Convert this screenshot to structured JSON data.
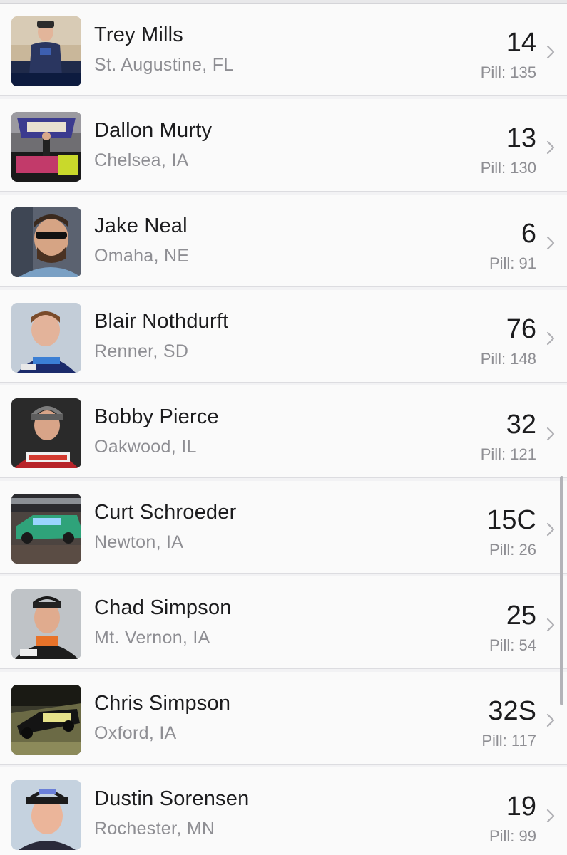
{
  "drivers": [
    {
      "name": "Trey Mills",
      "location": "St. Augustine, FL",
      "number": "14",
      "points": "Pill: 135",
      "avatar": "driver-photo"
    },
    {
      "name": "Dallon Murty",
      "location": "Chelsea, IA",
      "number": "13",
      "points": "Pill: 130",
      "avatar": "victory-lane-photo"
    },
    {
      "name": "Jake Neal",
      "location": "Omaha, NE",
      "number": "6",
      "points": "Pill: 91",
      "avatar": "driver-photo"
    },
    {
      "name": "Blair Nothdurft",
      "location": "Renner, SD",
      "number": "76",
      "points": "Pill: 148",
      "avatar": "driver-photo"
    },
    {
      "name": "Bobby Pierce",
      "location": "Oakwood, IL",
      "number": "32",
      "points": "Pill: 121",
      "avatar": "driver-photo"
    },
    {
      "name": "Curt Schroeder",
      "location": "Newton, IA",
      "number": "15C",
      "points": "Pill: 26",
      "avatar": "race-car-photo"
    },
    {
      "name": "Chad Simpson",
      "location": "Mt. Vernon, IA",
      "number": "25",
      "points": "Pill: 54",
      "avatar": "driver-photo"
    },
    {
      "name": "Chris Simpson",
      "location": "Oxford, IA",
      "number": "32S",
      "points": "Pill: 117",
      "avatar": "race-car-photo"
    },
    {
      "name": "Dustin Sorensen",
      "location": "Rochester, MN",
      "number": "19",
      "points": "Pill: 99",
      "avatar": "driver-photo"
    }
  ],
  "colors": {
    "background": "#f2f2f4",
    "row": "#fafafa",
    "primary_text": "#1c1c1e",
    "secondary_text": "#8e8e93",
    "separator": "#dcdce0"
  },
  "icons": {
    "chevron": "chevron-right-icon"
  }
}
